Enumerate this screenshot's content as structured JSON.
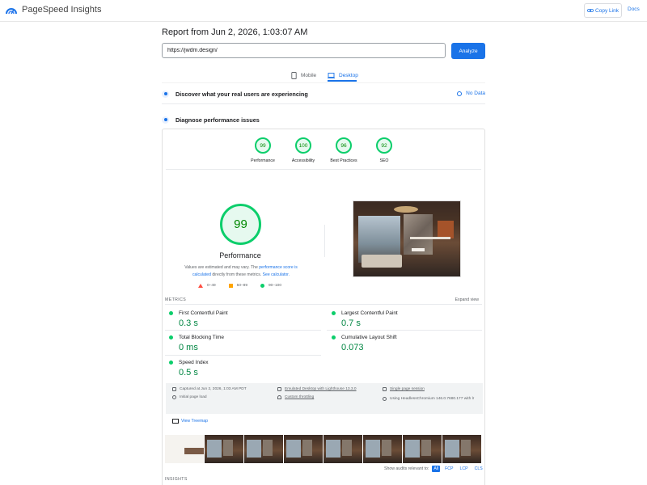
{
  "header": {
    "brand": "PageSpeed Insights",
    "copy_link": "Copy Link",
    "docs": "Docs"
  },
  "report": {
    "title": "Report from Jun 2, 2026, 1:03:07 AM",
    "url": "https://jwdm.design/",
    "analyze": "Analyze"
  },
  "tabs": [
    {
      "label": "Mobile",
      "active": false
    },
    {
      "label": "Desktop",
      "active": true
    }
  ],
  "sections": {
    "real_users": "Discover what your real users are experiencing",
    "no_data": "No Data",
    "diagnose": "Diagnose performance issues"
  },
  "scores": [
    {
      "value": "99",
      "label": "Performance"
    },
    {
      "value": "100",
      "label": "Accessibility"
    },
    {
      "value": "96",
      "label": "Best Practices"
    },
    {
      "value": "92",
      "label": "SEO"
    }
  ],
  "performance": {
    "score": "99",
    "label": "Performance",
    "disclaimer_1": "Values are estimated and may vary. The ",
    "disclaimer_link_1": "performance score is calculated",
    "disclaimer_2": " directly from these metrics. ",
    "disclaimer_link_2": "See calculator."
  },
  "legend": [
    {
      "range": "0–49",
      "color": "#ff4e42"
    },
    {
      "range": "50–89",
      "color": "#ffa400"
    },
    {
      "range": "90–100",
      "color": "#0cce6b"
    }
  ],
  "metrics": {
    "label": "METRICS",
    "expand": "Expand view",
    "items": [
      {
        "name": "First Contentful Paint",
        "value": "0.3 s"
      },
      {
        "name": "Largest Contentful Paint",
        "value": "0.7 s"
      },
      {
        "name": "Total Blocking Time",
        "value": "0 ms"
      },
      {
        "name": "Cumulative Layout Shift",
        "value": "0.073"
      },
      {
        "name": "Speed Index",
        "value": "0.5 s"
      }
    ]
  },
  "environment": {
    "captured": "Captured at Jun 2, 2026, 1:03 AM PDT",
    "initial_load": "Initial page load",
    "emulated": "Emulated Desktop with Lighthouse 13.3.0",
    "throttling": "Custom throttling",
    "session": "Single page session",
    "browser": "Using HeadlessChromium 146.0.7680.177 with lr"
  },
  "treemap": "View Treemap",
  "audits_filter": {
    "label": "Show audits relevant to:",
    "chips": [
      "All",
      "FCP",
      "LCP",
      "CLS"
    ]
  },
  "insights_label": "INSIGHTS"
}
